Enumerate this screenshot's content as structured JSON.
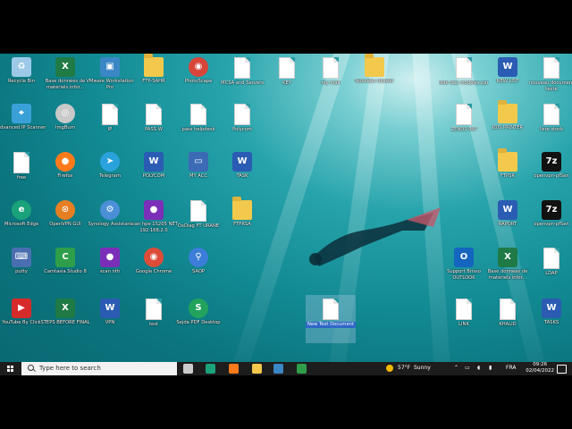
{
  "desktop_icons": [
    {
      "label": "Recycle Bin",
      "icon": "recycle-bin-icon",
      "glyph": "♻",
      "bg": "#9cc9e8",
      "kind": "sq"
    },
    {
      "label": "Base données de matériels infor...",
      "icon": "excel-icon",
      "glyph": "X",
      "bg": "#1f7a45",
      "kind": "sq"
    },
    {
      "label": "VMware Workstation Pro",
      "icon": "vmware-icon",
      "glyph": "▣",
      "bg": "#3b86c4",
      "kind": "sq"
    },
    {
      "label": "FTP-SAHR",
      "icon": "zip-folder-icon",
      "glyph": "",
      "bg": "",
      "kind": "folder"
    },
    {
      "label": "PhotoScape",
      "icon": "photoscape-icon",
      "glyph": "◉",
      "bg": "#d8453a",
      "kind": "circ"
    },
    {
      "label": "MCSA and Servers",
      "icon": "document-icon",
      "glyph": "",
      "bg": "",
      "kind": "doc"
    },
    {
      "label": "KEY",
      "icon": "document-icon",
      "glyph": "",
      "bg": "",
      "kind": "doc"
    },
    {
      "label": "my mail",
      "icon": "document-icon",
      "glyph": "",
      "bg": "",
      "kind": "doc"
    },
    {
      "label": "Nouveau dossier",
      "icon": "folder-icon",
      "glyph": "",
      "bg": "",
      "kind": "folder"
    },
    {
      "label": "liste des modèles par",
      "icon": "document-icon",
      "glyph": "",
      "bg": "",
      "kind": "doc"
    },
    {
      "label": "NEW LIST",
      "icon": "word-icon",
      "glyph": "W",
      "bg": "#2b5cb3",
      "kind": "sq"
    },
    {
      "label": "nouveau document texte",
      "icon": "document-icon",
      "glyph": "",
      "bg": "",
      "kind": "doc"
    },
    {
      "label": "Advanced IP Scanner",
      "icon": "ip-scanner-icon",
      "glyph": "⌖",
      "bg": "#3aa0d8",
      "kind": "sq"
    },
    {
      "label": "ImgBurn",
      "icon": "imgburn-icon",
      "glyph": "◎",
      "bg": "#c9c9c9",
      "kind": "circ"
    },
    {
      "label": "IP",
      "icon": "document-icon",
      "glyph": "",
      "bg": "",
      "kind": "doc"
    },
    {
      "label": "PASS W",
      "icon": "document-icon",
      "glyph": "",
      "bg": "",
      "kind": "doc"
    },
    {
      "label": "pass helpdesk",
      "icon": "document-icon",
      "glyph": "",
      "bg": "",
      "kind": "doc"
    },
    {
      "label": "Polycom",
      "icon": "document-icon",
      "glyph": "",
      "bg": "",
      "kind": "doc"
    },
    {
      "label": "ZENDS IMP",
      "icon": "document-icon",
      "glyph": "",
      "bg": "",
      "kind": "doc"
    },
    {
      "label": "JOIS PRINTER",
      "icon": "zip-folder-icon",
      "glyph": "",
      "bg": "",
      "kind": "folder"
    },
    {
      "label": "liste stock",
      "icon": "document-icon",
      "glyph": "",
      "bg": "",
      "kind": "doc"
    },
    {
      "label": "free",
      "icon": "document-icon",
      "glyph": "",
      "bg": "",
      "kind": "doc"
    },
    {
      "label": "Firefox",
      "icon": "firefox-icon",
      "glyph": "●",
      "bg": "#ff7a1a",
      "kind": "circ"
    },
    {
      "label": "Telegram",
      "icon": "telegram-icon",
      "glyph": "➤",
      "bg": "#2aa3dc",
      "kind": "circ"
    },
    {
      "label": "POLYCOM",
      "icon": "word-icon",
      "glyph": "W",
      "bg": "#2b5cb3",
      "kind": "sq"
    },
    {
      "label": "MY ACC",
      "icon": "pc-icon",
      "glyph": "▭",
      "bg": "#3c6bb5",
      "kind": "sq"
    },
    {
      "label": "TASK",
      "icon": "word-icon",
      "glyph": "W",
      "bg": "#2b5cb3",
      "kind": "sq"
    },
    {
      "label": "FTPSR",
      "icon": "zip-folder-icon",
      "glyph": "",
      "bg": "",
      "kind": "folder"
    },
    {
      "label": "openvpn-pfSen",
      "icon": "7z-sfx-icon",
      "glyph": "7z",
      "bg": "#111",
      "kind": "sq"
    },
    {
      "label": "Microsoft Edge",
      "icon": "edge-icon",
      "glyph": "e",
      "bg": "#1aa27a",
      "kind": "circ"
    },
    {
      "label": "OpenVPN GUI",
      "icon": "openvpn-icon",
      "glyph": "⊙",
      "bg": "#e67e22",
      "kind": "circ"
    },
    {
      "label": "Synology Assistant",
      "icon": "synology-icon",
      "glyph": "⚙",
      "bg": "#4b8fd6",
      "kind": "circ"
    },
    {
      "label": "scan hpe 15205 NET 192.168.2.0",
      "icon": "firefox-shortcut-icon",
      "glyph": "●",
      "bg": "#7b2fb8",
      "kind": "sq"
    },
    {
      "label": "DxDiag FT URANE",
      "icon": "document-icon",
      "glyph": "",
      "bg": "",
      "kind": "doc"
    },
    {
      "label": "FTPRSA",
      "icon": "zip-folder-icon",
      "glyph": "",
      "bg": "",
      "kind": "folder"
    },
    {
      "label": "RAPORT",
      "icon": "word-icon",
      "glyph": "W",
      "bg": "#2b5cb3",
      "kind": "sq"
    },
    {
      "label": "openvpn-pfSen",
      "icon": "7z-sfx-icon",
      "glyph": "7z",
      "bg": "#111",
      "kind": "sq"
    },
    {
      "label": "putty",
      "icon": "putty-icon",
      "glyph": "⌨",
      "bg": "#4a6fb0",
      "kind": "sq"
    },
    {
      "label": "Camtasia Studio 8",
      "icon": "camtasia-icon",
      "glyph": "C",
      "bg": "#2e9e4a",
      "kind": "sq"
    },
    {
      "label": "scan nth",
      "icon": "firefox-shortcut-icon",
      "glyph": "●",
      "bg": "#7b2fb8",
      "kind": "sq"
    },
    {
      "label": "Google Chrome",
      "icon": "chrome-icon",
      "glyph": "◉",
      "bg": "#dd4b39",
      "kind": "circ"
    },
    {
      "label": "SAOP",
      "icon": "saop-icon",
      "glyph": "⚲",
      "bg": "#3b7dd8",
      "kind": "circ"
    },
    {
      "label": "Support Brisso OUTLOOK",
      "icon": "outlook-icon",
      "glyph": "O",
      "bg": "#1565c0",
      "kind": "sq"
    },
    {
      "label": "Base données de matériels infor...",
      "icon": "excel-icon",
      "glyph": "X",
      "bg": "#1f7a45",
      "kind": "sq"
    },
    {
      "label": "LDAP",
      "icon": "document-icon",
      "glyph": "",
      "bg": "",
      "kind": "doc"
    },
    {
      "label": "YouTube By Click",
      "icon": "youtube-icon",
      "glyph": "▶",
      "bg": "#d62b2b",
      "kind": "sq"
    },
    {
      "label": "STEPS BEFORE FINAL",
      "icon": "excel-doc-icon",
      "glyph": "X",
      "bg": "#1f7a45",
      "kind": "sq"
    },
    {
      "label": "VPN",
      "icon": "word-icon",
      "glyph": "W",
      "bg": "#2b5cb3",
      "kind": "sq"
    },
    {
      "label": "test",
      "icon": "document-icon",
      "glyph": "",
      "bg": "",
      "kind": "doc"
    },
    {
      "label": "Sejda PDF Desktop",
      "icon": "sejda-icon",
      "glyph": "S",
      "bg": "#21a35c",
      "kind": "circ"
    },
    {
      "label": "New Text Document",
      "icon": "document-icon",
      "glyph": "",
      "bg": "",
      "kind": "doc",
      "selected": true
    },
    {
      "label": "LINK",
      "icon": "document-icon",
      "glyph": "",
      "bg": "",
      "kind": "doc"
    },
    {
      "label": "KHALID",
      "icon": "document-icon",
      "glyph": "",
      "bg": "",
      "kind": "doc"
    },
    {
      "label": "TASKS",
      "icon": "word-icon",
      "glyph": "W",
      "bg": "#2b5cb3",
      "kind": "sq"
    }
  ],
  "taskbar": {
    "search_placeholder": "Type here to search",
    "pinned": [
      {
        "name": "task-view",
        "color": "#cccccc"
      },
      {
        "name": "edge",
        "color": "#1aa27a"
      },
      {
        "name": "firefox",
        "color": "#ff7a1a"
      },
      {
        "name": "file-explorer",
        "color": "#f2c94c"
      },
      {
        "name": "vmware",
        "color": "#3b86c4"
      },
      {
        "name": "camtasia",
        "color": "#2e9e4a"
      }
    ],
    "weather_temp": "57°F",
    "weather_text": "Sunny",
    "language": "FRA",
    "time": "09:26",
    "date": "02/04/2022"
  }
}
